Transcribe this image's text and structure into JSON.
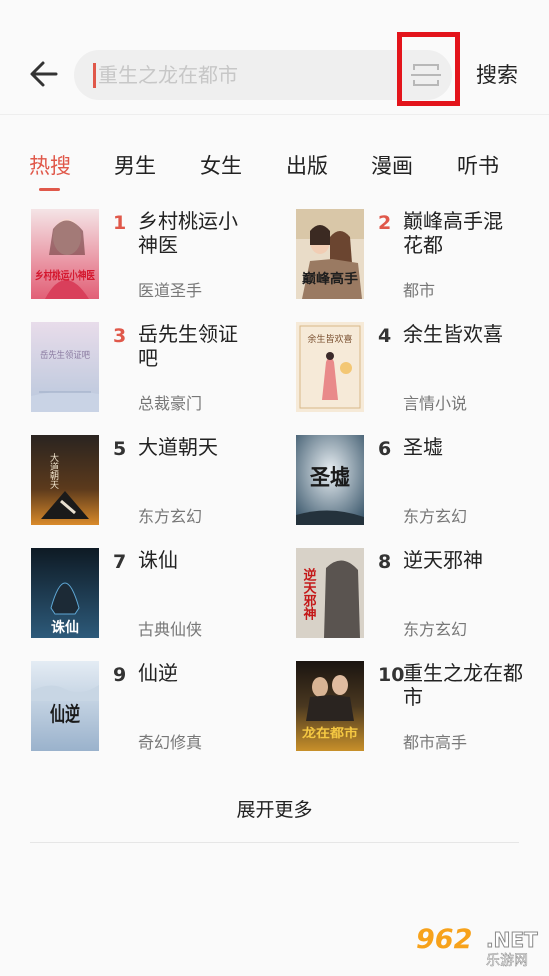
{
  "search": {
    "placeholder": "重生之龙在都市",
    "button_label": "搜索"
  },
  "tabs": [
    {
      "label": "热搜",
      "active": true
    },
    {
      "label": "男生",
      "active": false
    },
    {
      "label": "女生",
      "active": false
    },
    {
      "label": "出版",
      "active": false
    },
    {
      "label": "漫画",
      "active": false
    },
    {
      "label": "听书",
      "active": false
    }
  ],
  "books": [
    {
      "rank": "1",
      "title": "乡村桃运小神医",
      "category": "医道圣手",
      "cover_text": "乡村桃运小神医"
    },
    {
      "rank": "2",
      "title": "巅峰高手混花都",
      "category": "都市",
      "cover_text": "巅峰高手"
    },
    {
      "rank": "3",
      "title": "岳先生领证吧",
      "category": "总裁豪门",
      "cover_text": "岳先生领证吧"
    },
    {
      "rank": "4",
      "title": "余生皆欢喜",
      "category": "言情小说",
      "cover_text": "余生皆欢喜"
    },
    {
      "rank": "5",
      "title": "大道朝天",
      "category": "东方玄幻",
      "cover_text": "大道朝天"
    },
    {
      "rank": "6",
      "title": "圣墟",
      "category": "东方玄幻",
      "cover_text": "圣墟"
    },
    {
      "rank": "7",
      "title": "诛仙",
      "category": "古典仙侠",
      "cover_text": "诛仙"
    },
    {
      "rank": "8",
      "title": "逆天邪神",
      "category": "东方玄幻",
      "cover_text": "逆天邪神"
    },
    {
      "rank": "9",
      "title": "仙逆",
      "category": "奇幻修真",
      "cover_text": "仙逆"
    },
    {
      "rank": "10",
      "title": "重生之龙在都市",
      "category": "都市高手",
      "cover_text": "龙在都市"
    }
  ],
  "more_label": "展开更多",
  "watermark": {
    "num": "962",
    "net": ".NET",
    "cn": "乐游网"
  },
  "colors": {
    "accent": "#e0584a",
    "highlight_box": "#e3141b",
    "background": "#fafafa"
  }
}
